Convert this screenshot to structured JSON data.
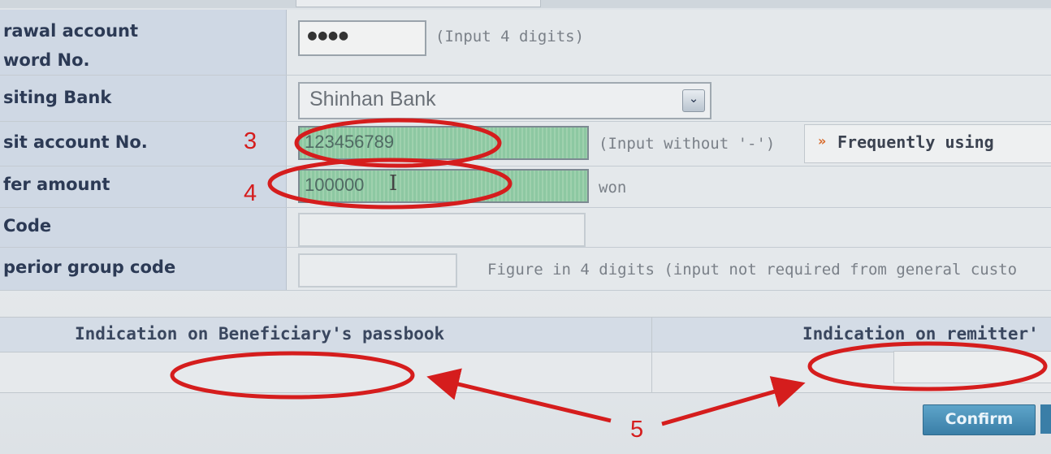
{
  "form": {
    "password_label": "rawal account\nword No.",
    "password_value": "●●●●",
    "password_hint": "(Input 4 digits)",
    "bank_label": "siting Bank",
    "bank_selected": "Shinhan Bank",
    "deposit_label": "sit account No.",
    "deposit_value": "123456789",
    "deposit_hint": "(Input without '-')",
    "frequently_label": "Frequently using",
    "amount_label": "fer amount",
    "amount_value": "100000",
    "amount_unit": "won",
    "code_label": "Code",
    "code_value": "",
    "group_label": "perior group code",
    "group_value": "",
    "group_hint": "Figure in 4 digits (input not required from general custo"
  },
  "passbook": {
    "beneficiary_label": "Indication on Beneficiary's passbook",
    "remitter_label": "Indication on remitter'",
    "beneficiary_value": "",
    "remitter_value": ""
  },
  "actions": {
    "confirm_label": "Confirm"
  },
  "annotations": {
    "marker_3": "3",
    "marker_4": "4",
    "marker_5": "5"
  },
  "colors": {
    "annotation_red": "#d51d1d",
    "label_bg": "#cfd8e4",
    "input_green": "#8dc8a2",
    "button_blue": "#3a7ea7"
  },
  "icons": {
    "dropdown": "chevron-down-icon",
    "frequently": "chevron-right-icon",
    "text_cursor": "text-cursor-icon"
  }
}
